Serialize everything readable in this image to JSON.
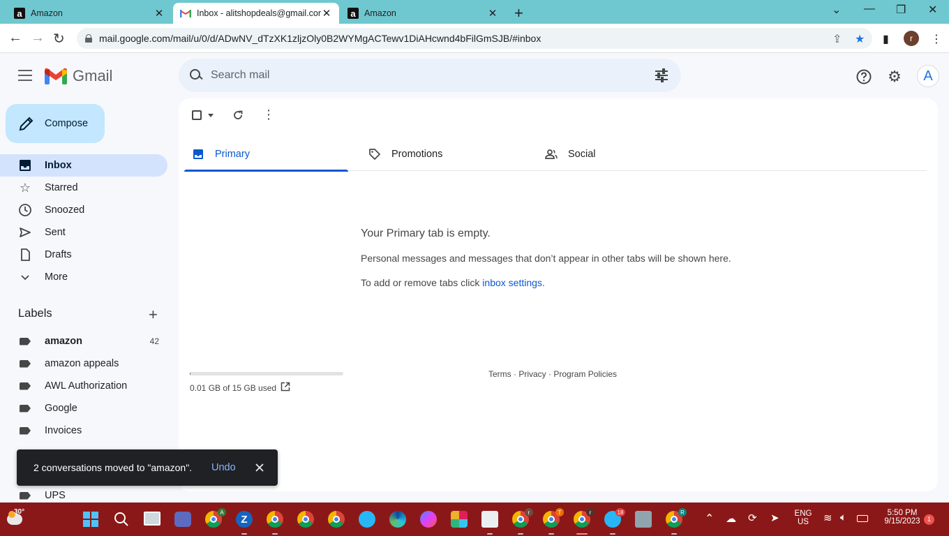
{
  "browser": {
    "tabs": [
      {
        "title": "Amazon",
        "favicon": "amazon-icon",
        "active": false
      },
      {
        "title": "Inbox - alitshopdeals@gmail.com",
        "favicon": "gmail-icon",
        "active": true
      },
      {
        "title": "Amazon",
        "favicon": "amazon-icon",
        "active": false
      }
    ],
    "url": "mail.google.com/mail/u/0/d/ADwNV_dTzXK1zljzOly0B2WYMgACTewv1DiAHcwnd4bFilGmSJB/#inbox",
    "profile_initial": "r"
  },
  "gmail": {
    "brand": "Gmail",
    "search_placeholder": "Search mail",
    "account_initial": "A",
    "compose_label": "Compose",
    "nav": [
      {
        "label": "Inbox",
        "icon": "inbox-icon",
        "active": true
      },
      {
        "label": "Starred",
        "icon": "star-icon",
        "active": false
      },
      {
        "label": "Snoozed",
        "icon": "clock-icon",
        "active": false
      },
      {
        "label": "Sent",
        "icon": "send-icon",
        "active": false
      },
      {
        "label": "Drafts",
        "icon": "draft-icon",
        "active": false
      },
      {
        "label": "More",
        "icon": "chevron-down-icon",
        "active": false
      }
    ],
    "labels_heading": "Labels",
    "labels": [
      {
        "name": "amazon",
        "count": "42",
        "bold": true
      },
      {
        "name": "amazon appeals",
        "count": ""
      },
      {
        "name": "AWL Authorization",
        "count": ""
      },
      {
        "name": "Google",
        "count": ""
      },
      {
        "name": "Invoices",
        "count": ""
      },
      {
        "name": "UPS",
        "count": ""
      }
    ],
    "tabs": [
      {
        "label": "Primary",
        "icon": "inbox-tab-icon",
        "active": true
      },
      {
        "label": "Promotions",
        "icon": "tag-icon",
        "active": false
      },
      {
        "label": "Social",
        "icon": "people-icon",
        "active": false
      }
    ],
    "empty": {
      "title": "Your Primary tab is empty.",
      "description": "Personal messages and messages that don’t appear in other tabs will be shown here.",
      "settings_prefix": "To add or remove tabs click ",
      "settings_link": "inbox settings",
      "settings_suffix": "."
    },
    "storage": {
      "text": "0.01 GB of 15 GB used",
      "fraction": 0.001
    },
    "footer": {
      "terms": "Terms",
      "privacy": "Privacy",
      "policies": "Program Policies",
      "sep": " · "
    },
    "snackbar": {
      "message": "2 conversations moved to \"amazon\".",
      "undo": "Undo"
    }
  },
  "taskbar": {
    "weather": "30°",
    "lang_top": "ENG",
    "lang_bottom": "US",
    "time": "5:50 PM",
    "date": "9/15/2023",
    "notification_count": "1",
    "telegram_badge": "18",
    "avatar_letters": [
      "A",
      "r",
      "T",
      "r",
      "R"
    ]
  },
  "colors": {
    "tabbar": "#6fc8cf",
    "active_nav": "#d3e3fd",
    "compose": "#c2e7ff",
    "accent": "#0b57d0",
    "taskbar": "#8b1818"
  }
}
